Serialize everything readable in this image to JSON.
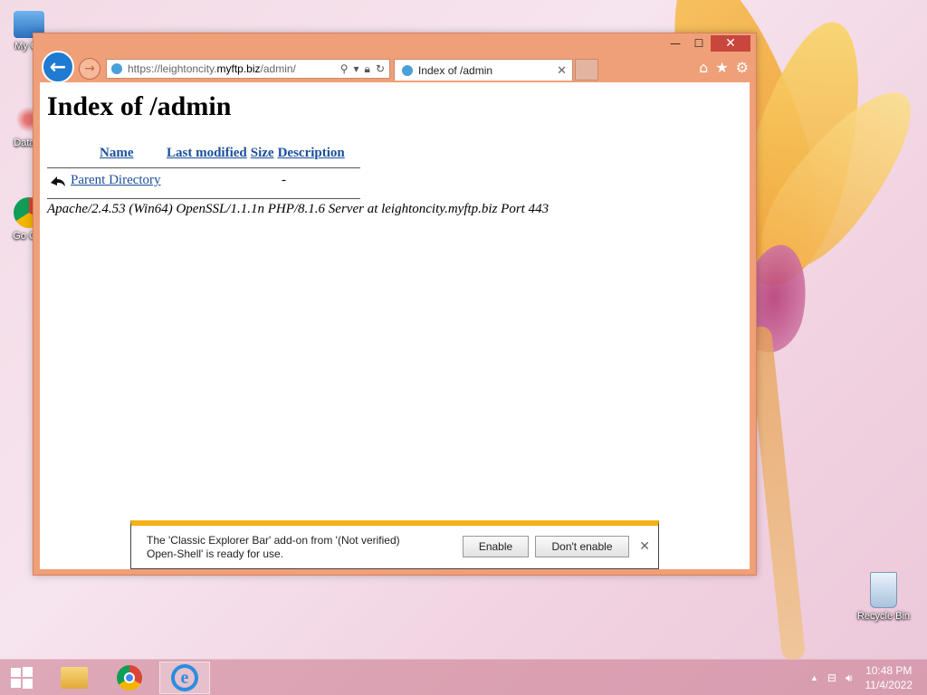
{
  "desktop": {
    "icons": [
      {
        "label": "My Co"
      },
      {
        "label": "DataW"
      },
      {
        "label": "Go Chr"
      },
      {
        "label": "Recycle Bin"
      }
    ]
  },
  "browser": {
    "window_controls": {
      "minimize": "—",
      "maximize": "☐",
      "close": "✕"
    },
    "address": {
      "prefix": "https://leightoncity.",
      "domain": "myftp.biz",
      "path": "/admin/"
    },
    "tab": {
      "title": "Index of /admin",
      "close": "✕"
    },
    "toolbar": {
      "home": "⌂",
      "favorites": "★",
      "settings": "⚙"
    }
  },
  "page": {
    "heading": "Index of /admin",
    "columns": [
      "Name",
      "Last modified",
      "Size",
      "Description"
    ],
    "rows": [
      {
        "name": "Parent Directory",
        "modified": "",
        "size": "-",
        "description": ""
      }
    ],
    "server_signature": "Apache/2.4.53 (Win64) OpenSSL/1.1.1n PHP/8.1.6 Server at leightoncity.myftp.biz Port 443"
  },
  "notification": {
    "message": "The 'Classic Explorer Bar' add-on from '(Not verified) Open-Shell' is ready for use.",
    "enable_label": "Enable",
    "dont_enable_label": "Don't enable",
    "close": "✕"
  },
  "taskbar": {
    "clock_time": "10:48 PM",
    "clock_date": "11/4/2022"
  }
}
